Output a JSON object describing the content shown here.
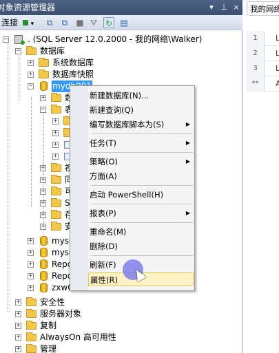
{
  "panel": {
    "title": "对象资源管理器",
    "pin_glyph": "▾",
    "pin2_glyph": "ᵖ",
    "close_glyph": "×",
    "toolbar": {
      "connect_label": "连接",
      "connect_arrow": "▾"
    }
  },
  "tree": {
    "server_label": ". (SQL Server 12.0.2000 - 我的网络\\Walker)",
    "databases_label": "数据库",
    "system_db_label": "系统数据库",
    "snapshot_label": "数据库快照",
    "selected_db_label": "mydb001",
    "sub_items": [
      "数",
      "表",
      "",
      "",
      "",
      "",
      "视",
      "同",
      "可",
      "S",
      "存",
      "安"
    ],
    "db_items": [
      "myse",
      "myse",
      "Repo",
      "Repo",
      "zxw001"
    ],
    "security_label": "安全性",
    "server_objects_label": "服务器对象",
    "replication_label": "复制",
    "alwayson_label": "AlwaysOn 高可用性",
    "management_label": "管理"
  },
  "document": {
    "tab_label": "我的网络",
    "rows": [
      {
        "num": "1",
        "cell": "L"
      },
      {
        "num": "2",
        "cell": "L"
      },
      {
        "num": "3",
        "cell": "L"
      },
      {
        "num": "**",
        "cell": "A"
      }
    ]
  },
  "context_menu": {
    "items": [
      {
        "label": "新建数据库(N)...",
        "submenu": false
      },
      {
        "label": "新建查询(Q)",
        "submenu": false
      },
      {
        "label": "编写数据库脚本为(S)",
        "submenu": true
      },
      {
        "label": "任务(T)",
        "submenu": true
      },
      {
        "label": "策略(O)",
        "submenu": true
      },
      {
        "label": "方面(A)",
        "submenu": false
      },
      {
        "label": "启动 PowerShell(H)",
        "submenu": false
      },
      {
        "label": "报表(P)",
        "submenu": true
      },
      {
        "label": "重命名(M)",
        "submenu": false
      },
      {
        "label": "删除(D)",
        "submenu": false
      },
      {
        "label": "刷新(F)",
        "submenu": false
      },
      {
        "label": "属性(R)",
        "submenu": false
      }
    ],
    "submenu_arrow": "▶"
  }
}
